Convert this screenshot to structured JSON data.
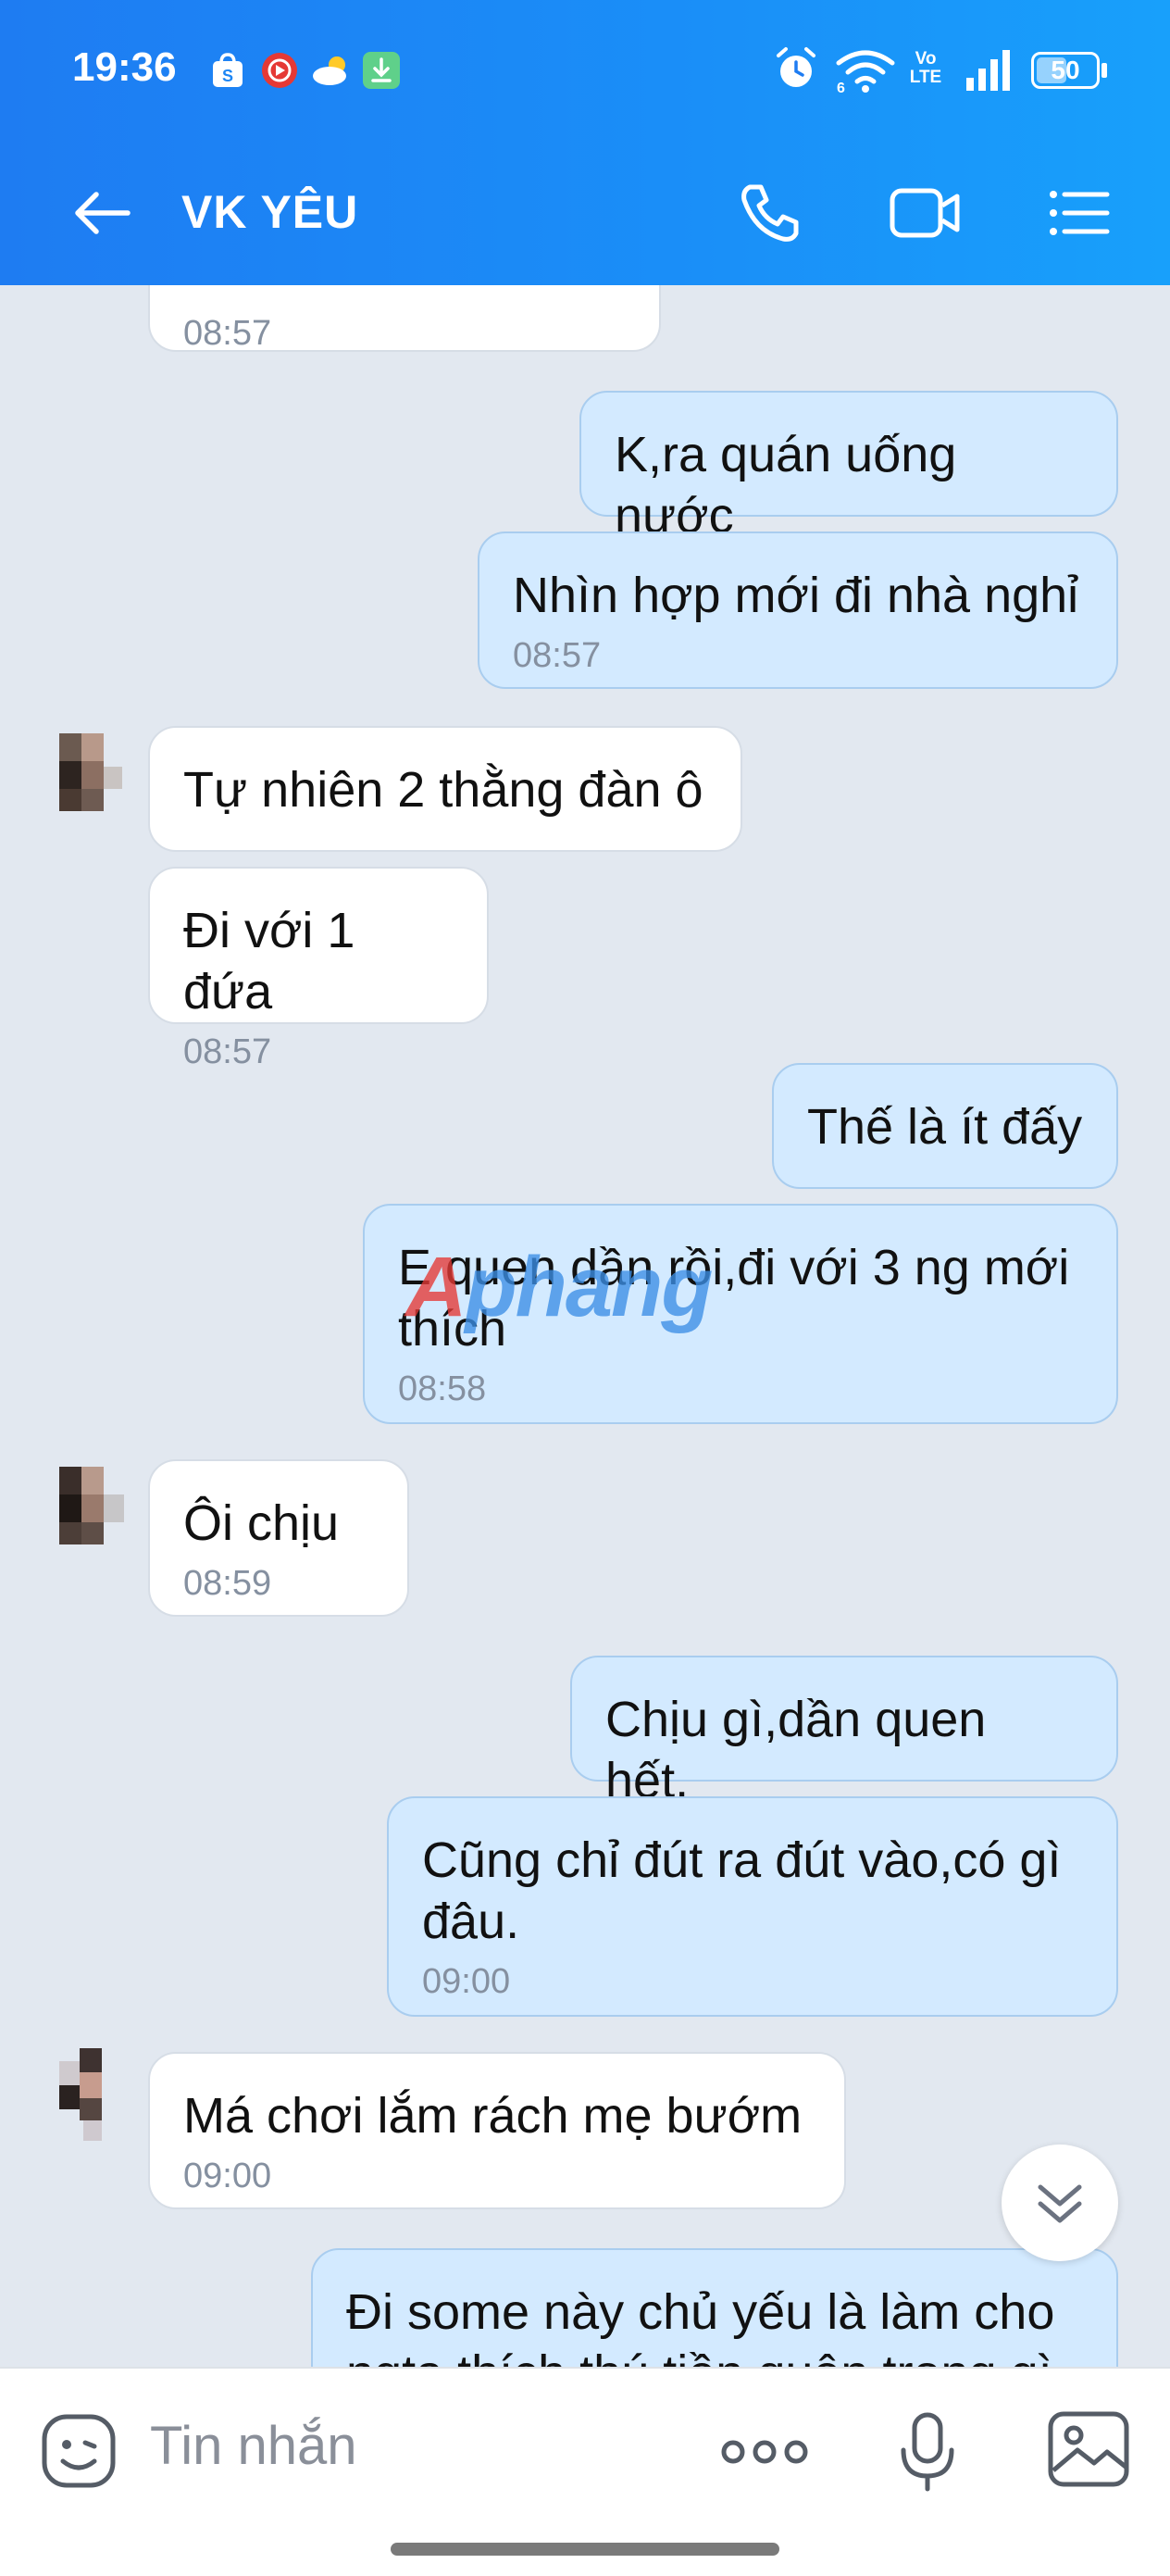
{
  "status_bar": {
    "time": "19:36",
    "battery": "50",
    "network": "Vo LTE",
    "wifi": "6",
    "icons": [
      "shopee-icon",
      "youtube-music-icon",
      "weather-icon",
      "download-icon",
      "alarm-icon",
      "wifi-icon",
      "volte-icon",
      "signal-icon",
      "battery-icon"
    ]
  },
  "header": {
    "title": "VK YÊU",
    "back_icon": "back-arrow-icon",
    "call_icon": "phone-icon",
    "video_icon": "video-call-icon",
    "menu_icon": "list-menu-icon",
    "color_start": "#1e7cf2",
    "color_end": "#18a0fb"
  },
  "messages": [
    {
      "direction": "in",
      "text": "",
      "time": "08:57"
    },
    {
      "direction": "out",
      "text": "K,ra quán uống nước",
      "time": ""
    },
    {
      "direction": "out",
      "text": "Nhìn hợp mới đi nhà nghỉ",
      "time": "08:57"
    },
    {
      "direction": "in",
      "text": "Tự nhiên 2 thằng đàn ô",
      "time": ""
    },
    {
      "direction": "in",
      "text": "Đi với 1 đứa",
      "time": "08:57"
    },
    {
      "direction": "out",
      "text": "Thế là ít đấy",
      "time": ""
    },
    {
      "direction": "out",
      "text": "E quen dần rồi,đi với 3 ng mới thích",
      "time": "08:58"
    },
    {
      "direction": "in",
      "text": "Ôi chịu",
      "time": "08:59"
    },
    {
      "direction": "out",
      "text": "Chịu gì,dần quen hết.",
      "time": ""
    },
    {
      "direction": "out",
      "text": "Cũng chỉ đút ra đút vào,có gì đâu.",
      "time": "09:00"
    },
    {
      "direction": "in",
      "text": "Má chơi lắm rách mẹ bướm",
      "time": "09:00"
    },
    {
      "direction": "out",
      "text": "Đi some này chủ yếu là làm cho ngta thích thú tiền quên trong gì",
      "time": ""
    }
  ],
  "watermark": {
    "first": "A",
    "rest": "phang"
  },
  "scroll_button_icon": "double-chevron-down-icon",
  "input_bar": {
    "placeholder": "Tin nhắn",
    "sticker_icon": "sticker-icon",
    "more_icon": "more-dots-icon",
    "mic_icon": "microphone-icon",
    "image_icon": "image-icon"
  },
  "colors": {
    "chat_bg": "#e2e8f0",
    "out_bubble": "#d3eaff",
    "in_bubble": "#ffffff",
    "time_text": "#8590a0"
  }
}
